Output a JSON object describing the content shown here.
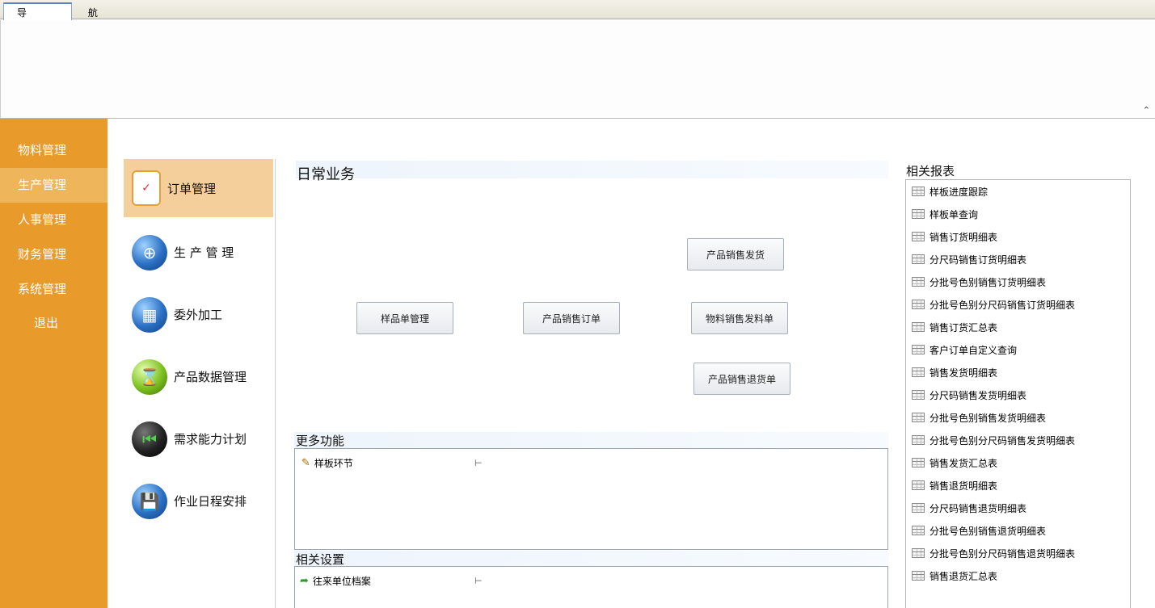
{
  "tab": {
    "label": "导 航"
  },
  "leftnav": {
    "items": [
      "物料管理",
      "生产管理",
      "人事管理",
      "财务管理",
      "系统管理"
    ],
    "exit": "退出"
  },
  "modules": [
    "订单管理",
    "生 产 管 理",
    "委外加工",
    "产品数据管理",
    "需求能力计划",
    "作业日程安排"
  ],
  "daily": {
    "title": "日常业务",
    "buttons": {
      "sample_order": "样品单管理",
      "sales_order": "产品销售订单",
      "delivery": "产品销售发货",
      "material_issue": "物料销售发料单",
      "sales_return": "产品销售退货单"
    }
  },
  "more": {
    "title": "更多功能",
    "items": [
      "样板环节"
    ]
  },
  "settings": {
    "title": "相关设置",
    "items": [
      "往来单位档案"
    ]
  },
  "reports": {
    "title": "相关报表",
    "items": [
      "样板进度跟踪",
      "样板单查询",
      "销售订货明细表",
      "分尺码销售订货明细表",
      "分批号色别销售订货明细表",
      "分批号色别分尺码销售订货明细表",
      "销售订货汇总表",
      "客户订单自定义查询",
      "销售发货明细表",
      "分尺码销售发货明细表",
      "分批号色别销售发货明细表",
      "分批号色别分尺码销售发货明细表",
      "销售发货汇总表",
      "销售退货明细表",
      "分尺码销售退货明细表",
      "分批号色别销售退货明细表",
      "分批号色别分尺码销售退货明细表",
      "销售退货汇总表"
    ]
  },
  "icons": {
    "collapse": "chevron-up-icon",
    "pin": "pin-icon"
  }
}
